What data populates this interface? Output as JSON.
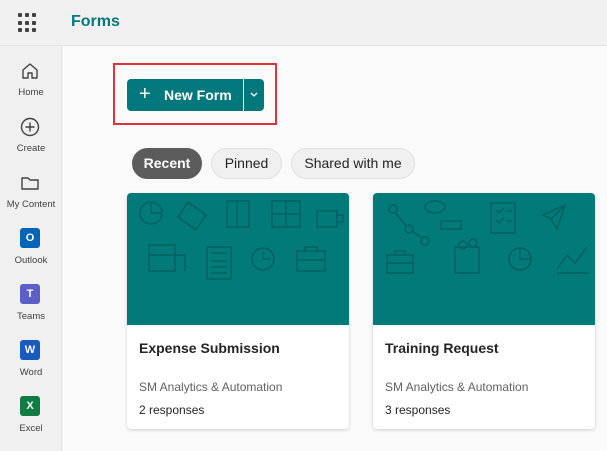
{
  "app": {
    "name": "Forms"
  },
  "rail": [
    {
      "label": "Home",
      "icon": "home-icon"
    },
    {
      "label": "Create",
      "icon": "plus-circle-icon"
    },
    {
      "label": "My Content",
      "icon": "folder-icon"
    },
    {
      "label": "Outlook",
      "icon": "outlook-icon",
      "letter": "O",
      "color": "#0364b8"
    },
    {
      "label": "Teams",
      "icon": "teams-icon",
      "letter": "T",
      "color": "#5b5fc7"
    },
    {
      "label": "Word",
      "icon": "word-icon",
      "letter": "W",
      "color": "#185abd"
    },
    {
      "label": "Excel",
      "icon": "excel-icon",
      "letter": "X",
      "color": "#107c41"
    }
  ],
  "toolbar": {
    "new_form_label": "New Form",
    "plus": "+"
  },
  "filters": [
    {
      "label": "Recent",
      "active": true
    },
    {
      "label": "Pinned",
      "active": false
    },
    {
      "label": "Shared with me",
      "active": false
    }
  ],
  "cards": [
    {
      "title": "Expense Submission",
      "owner": "SM Analytics & Automation",
      "responses": "2 responses"
    },
    {
      "title": "Training Request",
      "owner": "SM Analytics & Automation",
      "responses": "3 responses"
    }
  ],
  "colors": {
    "accent": "#03787c",
    "banner": "#027a7a",
    "highlight": "#e0313d"
  }
}
